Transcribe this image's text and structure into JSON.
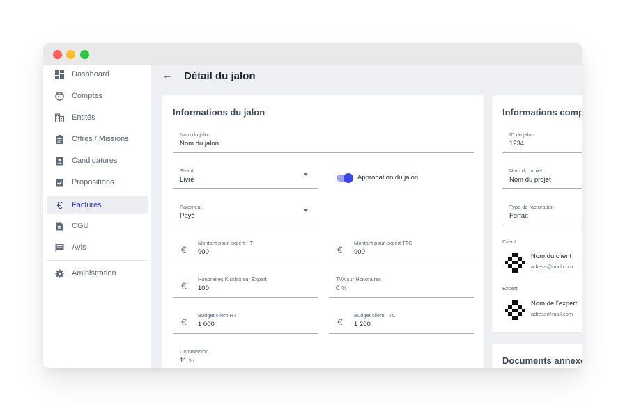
{
  "window": {
    "traffic_lights": [
      "close",
      "minimize",
      "maximize"
    ]
  },
  "sidebar": {
    "items": [
      {
        "label": "Dashboard",
        "icon": "dashboard-icon"
      },
      {
        "label": "Comptes",
        "icon": "face-icon"
      },
      {
        "label": "Entités",
        "icon": "building-icon"
      },
      {
        "label": "Offres / Missions",
        "icon": "clipboard-icon"
      },
      {
        "label": "Candidatures",
        "icon": "badge-icon"
      },
      {
        "label": "Propositions",
        "icon": "check-box-icon"
      },
      {
        "label": "Factures",
        "icon": "euro-icon",
        "active": true
      },
      {
        "label": "CGU",
        "icon": "document-icon"
      },
      {
        "label": "Avis",
        "icon": "comment-icon"
      }
    ],
    "admin": {
      "label": "Aministration",
      "icon": "gear-icon"
    }
  },
  "header": {
    "back_icon": "arrow-left-icon",
    "title": "Détail du jalon"
  },
  "main_card": {
    "title": "Informations du jalon",
    "nom": {
      "label": "Nom du jalon",
      "value": "Nom du jalon"
    },
    "statut": {
      "label": "Statut",
      "value": "Livré"
    },
    "approbation": {
      "label": "Approbation du jalon",
      "on": true
    },
    "paiement": {
      "label": "Paiement",
      "value": "Payé"
    },
    "montant_ht": {
      "label": "Montant pour expert HT",
      "value": "900"
    },
    "montant_ttc": {
      "label": "Montant pour expert TTC",
      "value": "900"
    },
    "honoraires": {
      "label": "Honoraires Kicklox sur Expert",
      "value": "100"
    },
    "tva": {
      "label": "TVA sur Honoraires",
      "value": "0",
      "unit": "%"
    },
    "budget_ht": {
      "label": "Budget client HT",
      "value": "1 000"
    },
    "budget_ttc": {
      "label": "Budget client TTC",
      "value": "1 200"
    },
    "commission": {
      "label": "Commission",
      "value": "11",
      "unit": "%"
    },
    "currency_symbol": "€"
  },
  "side_card": {
    "title": "Informations compl",
    "id_jalon": {
      "label": "ID du jalon",
      "value": "1234"
    },
    "nom_projet": {
      "label": "Nom du projet",
      "value": "Nom du projet"
    },
    "type_facturation": {
      "label": "Type de facturation",
      "value": "Forfait"
    },
    "client": {
      "section": "Client",
      "name": "Nom du client",
      "email": "adress@mail.com"
    },
    "expert": {
      "section": "Expert",
      "name": "Nom de l'expert",
      "email": "adress@mail.com"
    }
  },
  "docs_card": {
    "title": "Documents annexes"
  },
  "colors": {
    "accent": "#2f3dd6",
    "toggle": "#3d47e3",
    "text": "#1f2733",
    "muted": "#5e6a78"
  }
}
